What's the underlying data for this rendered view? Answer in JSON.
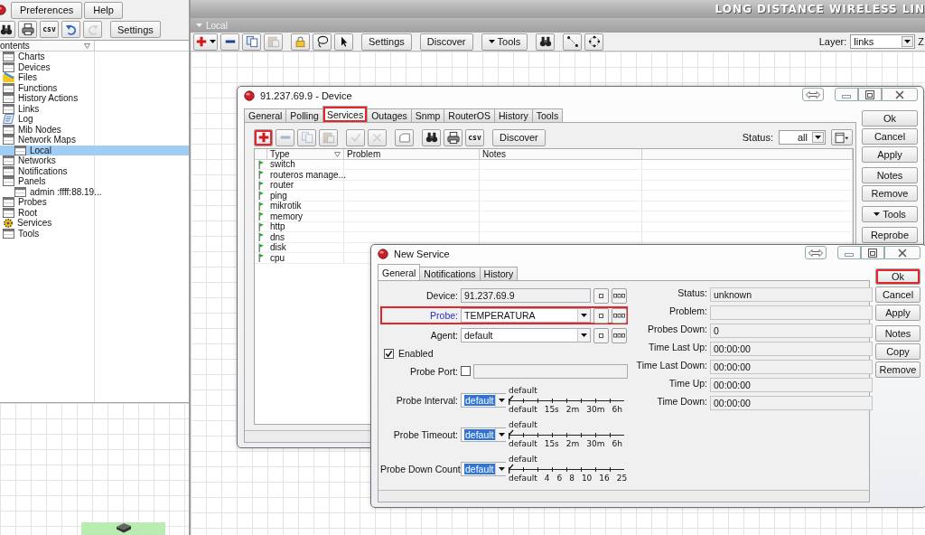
{
  "sidebar": {
    "menu_buttons": [
      "Preferences",
      "Help"
    ],
    "toolbar": [
      [
        {
          "kind": "find",
          "disabled": false
        },
        {
          "kind": "print",
          "disabled": false
        },
        {
          "kind": "csv",
          "label": "csv",
          "disabled": false
        },
        {
          "kind": "undo",
          "disabled": false
        },
        {
          "kind": "redo",
          "disabled": true
        }
      ],
      [
        {
          "kind": "text",
          "label": "Settings",
          "disabled": false
        }
      ]
    ],
    "tree": {
      "column": "ontents",
      "items": [
        {
          "label": "Charts",
          "kind": "table",
          "selected": false
        },
        {
          "label": "Devices",
          "kind": "table",
          "selected": false
        },
        {
          "label": "Files",
          "kind": "folder",
          "selected": false
        },
        {
          "label": "Functions",
          "kind": "table",
          "selected": false
        },
        {
          "label": "History Actions",
          "kind": "table",
          "selected": false
        },
        {
          "label": "Links",
          "kind": "table",
          "selected": false
        },
        {
          "label": "Log",
          "kind": "log",
          "selected": false
        },
        {
          "label": "Mib Nodes",
          "kind": "table",
          "selected": false
        },
        {
          "label": "Network Maps",
          "kind": "table",
          "selected": false,
          "children": [
            {
              "label": "Local",
              "kind": "table",
              "selected": true
            }
          ]
        },
        {
          "label": "Networks",
          "kind": "table",
          "selected": false
        },
        {
          "label": "Notifications",
          "kind": "table",
          "selected": false
        },
        {
          "label": "Panels",
          "kind": "table",
          "selected": false,
          "children": [
            {
              "label": "admin :ffff:88.19...",
              "kind": "table",
              "selected": false
            }
          ]
        },
        {
          "label": "Probes",
          "kind": "table",
          "selected": false
        },
        {
          "label": "Root",
          "kind": "table",
          "selected": false
        },
        {
          "label": "Services",
          "kind": "services",
          "selected": false
        },
        {
          "label": "Tools",
          "kind": "table",
          "selected": false
        }
      ]
    }
  },
  "workspace": {
    "banner": "LONG DISTANCE WIRELESS LIN",
    "map_title": "Local",
    "toolbar": [
      [
        {
          "kind": "add_menu",
          "disabled": false
        },
        {
          "kind": "remove",
          "disabled": false
        },
        {
          "kind": "copy",
          "disabled": false
        },
        {
          "kind": "paste",
          "disabled": true
        }
      ],
      [
        {
          "kind": "lock",
          "disabled": false
        },
        {
          "kind": "lasso",
          "disabled": false
        },
        {
          "kind": "pointer",
          "disabled": false
        }
      ],
      [
        {
          "kind": "text",
          "label": "Settings",
          "disabled": false
        }
      ],
      [
        {
          "kind": "text",
          "label": "Discover",
          "disabled": false
        }
      ],
      [
        {
          "kind": "menu",
          "label": "Tools",
          "disabled": false
        }
      ],
      [
        {
          "kind": "find",
          "disabled": false
        }
      ],
      [
        {
          "kind": "connect",
          "disabled": false
        },
        {
          "kind": "layout",
          "disabled": false
        }
      ]
    ],
    "layer_label": "Layer:",
    "layer_value": "links",
    "edge_label": "Z"
  },
  "device_window": {
    "title": "91.237.69.9 - Device",
    "tabs": [
      {
        "label": "General",
        "selected": false,
        "highlighted": false
      },
      {
        "label": "Polling",
        "selected": false,
        "highlighted": false
      },
      {
        "label": "Services",
        "selected": true,
        "highlighted": true
      },
      {
        "label": "Outages",
        "selected": false,
        "highlighted": false
      },
      {
        "label": "Snmp",
        "selected": false,
        "highlighted": false
      },
      {
        "label": "RouterOS",
        "selected": false,
        "highlighted": false
      },
      {
        "label": "History",
        "selected": false,
        "highlighted": false
      },
      {
        "label": "Tools",
        "selected": false,
        "highlighted": false
      }
    ],
    "toolbar": [
      [
        {
          "kind": "add",
          "disabled": false,
          "highlighted": true
        },
        {
          "kind": "remove",
          "disabled": true,
          "highlighted": false
        },
        {
          "kind": "copy",
          "disabled": true,
          "highlighted": false
        },
        {
          "kind": "paste",
          "disabled": true,
          "highlighted": false
        }
      ],
      [
        {
          "kind": "check",
          "disabled": true,
          "highlighted": false
        },
        {
          "kind": "cross",
          "disabled": true,
          "highlighted": false
        }
      ],
      [
        {
          "kind": "comment",
          "disabled": false,
          "highlighted": false
        }
      ],
      [
        {
          "kind": "find",
          "disabled": false,
          "highlighted": false
        },
        {
          "kind": "print",
          "disabled": false,
          "highlighted": false
        },
        {
          "kind": "csv",
          "label": "csv",
          "disabled": false,
          "highlighted": false
        }
      ],
      [
        {
          "kind": "text",
          "label": "Discover",
          "disabled": false,
          "highlighted": false
        }
      ]
    ],
    "status_label": "Status:",
    "status_value": "all",
    "table": {
      "columns": [
        "Type",
        "Problem",
        "Notes"
      ],
      "rows": [
        {
          "type": "switch"
        },
        {
          "type": "routeros manage..."
        },
        {
          "type": "router"
        },
        {
          "type": "ping"
        },
        {
          "type": "mikrotik"
        },
        {
          "type": "memory"
        },
        {
          "type": "http"
        },
        {
          "type": "dns"
        },
        {
          "type": "disk"
        },
        {
          "type": "cpu"
        }
      ]
    },
    "button_groups": [
      [
        {
          "label": "Ok",
          "kind": "plain",
          "highlighted": false
        },
        {
          "label": "Cancel",
          "kind": "plain",
          "highlighted": false
        },
        {
          "label": "Apply",
          "kind": "plain",
          "highlighted": false
        }
      ],
      [
        {
          "label": "Notes",
          "kind": "plain",
          "highlighted": false
        },
        {
          "label": "Remove",
          "kind": "plain",
          "highlighted": false
        }
      ],
      [
        {
          "label": "Tools",
          "kind": "menu",
          "highlighted": false
        }
      ],
      [
        {
          "label": "Reprobe",
          "kind": "plain",
          "highlighted": false
        }
      ]
    ]
  },
  "service_window": {
    "title": "New Service",
    "tabs": [
      {
        "label": "General",
        "selected": true
      },
      {
        "label": "Notifications",
        "selected": false
      },
      {
        "label": "History",
        "selected": false
      }
    ],
    "fields": [
      {
        "kind": "text",
        "label": "Device:",
        "value": "91.237.69.9",
        "link": false,
        "highlighted": false
      },
      {
        "kind": "select",
        "label": "Probe:",
        "value": "TEMPERATURA",
        "link": true,
        "highlighted": true
      },
      {
        "kind": "select",
        "label": "Agent:",
        "value": "default",
        "link": false,
        "highlighted": false
      }
    ],
    "enabled": {
      "label": "Enabled",
      "checked": true
    },
    "probe_port": {
      "label": "Probe Port:",
      "checked": false
    },
    "scales": [
      {
        "label": "Probe Interval:",
        "value": "default",
        "text_selected": true,
        "current": "default",
        "ticks": [
          "default",
          "15s",
          "2m",
          "30m",
          "6h"
        ],
        "level": 0
      },
      {
        "label": "Probe Timeout:",
        "value": "default",
        "text_selected": true,
        "current": "default",
        "ticks": [
          "default",
          "15s",
          "2m",
          "30m",
          "6h"
        ],
        "level": 0
      },
      {
        "label": "Probe Down Count:",
        "value": "default",
        "text_selected": true,
        "current": "default",
        "ticks": [
          "default",
          "4",
          "6",
          "8",
          "10",
          "16",
          "25"
        ],
        "level": 0
      }
    ],
    "status_fields": [
      {
        "label": "Status:",
        "value": "unknown"
      },
      {
        "label": "Problem:"
      },
      {
        "label": "Probes Down:",
        "value": "0"
      },
      {
        "label": "Time Last Up:",
        "value": "00:00:00"
      },
      {
        "label": "Time Last Down:",
        "value": "00:00:00"
      },
      {
        "label": "Time Up:",
        "value": "00:00:00"
      },
      {
        "label": "Time Down:",
        "value": "00:00:00"
      }
    ],
    "button_groups": [
      [
        {
          "label": "Ok",
          "kind": "plain",
          "highlighted": true
        },
        {
          "label": "Cancel",
          "kind": "plain",
          "highlighted": false
        },
        {
          "label": "Apply",
          "kind": "plain",
          "highlighted": false
        }
      ],
      [
        {
          "label": "Notes",
          "kind": "plain",
          "highlighted": false
        },
        {
          "label": "Copy",
          "kind": "plain",
          "highlighted": false
        },
        {
          "label": "Remove",
          "kind": "plain",
          "highlighted": false
        }
      ]
    ]
  }
}
